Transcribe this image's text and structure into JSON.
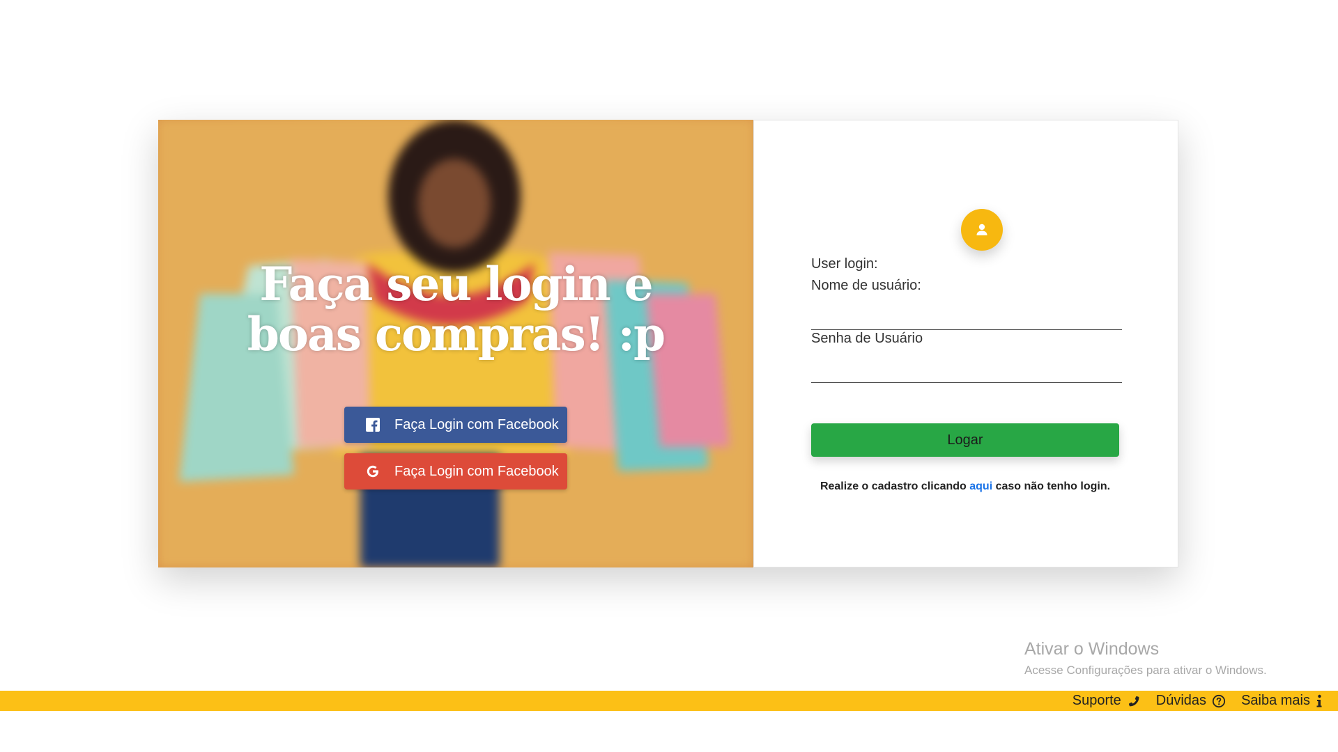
{
  "hero": {
    "title": "Faça seu login e boas compras! :p",
    "facebook_button_label": "Faça Login com Facebook",
    "google_button_label": "Faça Login com Facebook"
  },
  "form": {
    "user_login_label": "User login:",
    "username_label": "Nome de usuário:",
    "password_label": "Senha de Usuário",
    "username_value": "",
    "password_value": "",
    "submit_label": "Logar",
    "register_prefix": "Realize o cadastro clicando ",
    "register_link": "aqui",
    "register_suffix": " caso não tenho login."
  },
  "windows_notice": {
    "title": "Ativar o Windows",
    "subtitle": "Acesse Configurações para ativar o Windows."
  },
  "footer": {
    "items": [
      {
        "label": "Suporte",
        "icon": "phone-icon"
      },
      {
        "label": "Dúvidas",
        "icon": "question-circle-icon"
      },
      {
        "label": "Saiba mais",
        "icon": "info-icon"
      }
    ]
  },
  "colors": {
    "accent_yellow": "#fcc016",
    "login_green": "#28a745",
    "facebook_blue": "#3b5998",
    "google_red": "#dd4b39",
    "link_blue": "#1a73e8"
  }
}
